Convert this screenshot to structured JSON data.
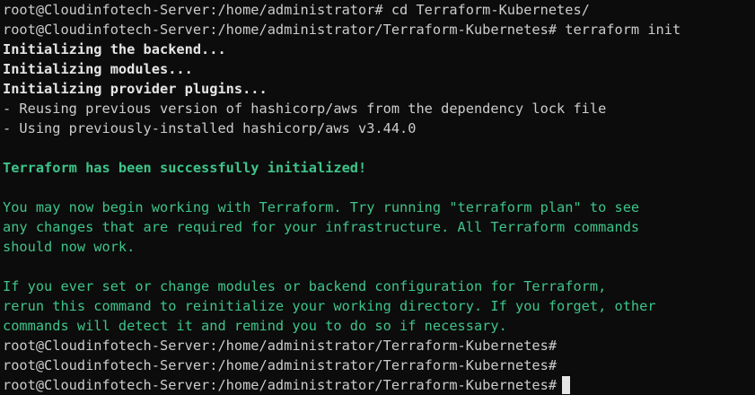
{
  "terminal": {
    "lines": {
      "l0": "root@Cloudinfotech-Server:/home/administrator# cd Terraform-Kubernetes/",
      "l1": "root@Cloudinfotech-Server:/home/administrator/Terraform-Kubernetes# terraform init",
      "l2": "Initializing the backend...",
      "l3": "Initializing modules...",
      "l4": "Initializing provider plugins...",
      "l5": "- Reusing previous version of hashicorp/aws from the dependency lock file",
      "l6": "- Using previously-installed hashicorp/aws v3.44.0",
      "l8": "Terraform has been successfully initialized!",
      "l10": "You may now begin working with Terraform. Try running \"terraform plan\" to see",
      "l11": "any changes that are required for your infrastructure. All Terraform commands",
      "l12": "should now work.",
      "l14": "If you ever set or change modules or backend configuration for Terraform,",
      "l15": "rerun this command to reinitialize your working directory. If you forget, other",
      "l16": "commands will detect it and remind you to do so if necessary.",
      "l17": "root@Cloudinfotech-Server:/home/administrator/Terraform-Kubernetes#",
      "l18": "root@Cloudinfotech-Server:/home/administrator/Terraform-Kubernetes#",
      "l19": "root@Cloudinfotech-Server:/home/administrator/Terraform-Kubernetes#"
    },
    "colors": {
      "background": "#0c0c0c",
      "text": "#cccccc",
      "bold_text": "#e6e6e6",
      "green": "#3ec48a"
    }
  }
}
